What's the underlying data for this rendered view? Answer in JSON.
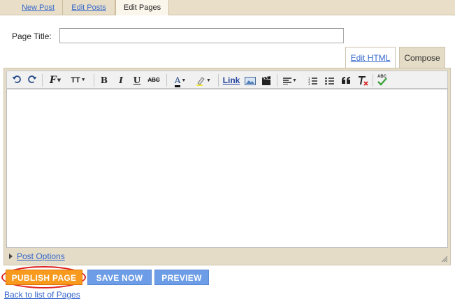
{
  "top_tabs": [
    {
      "label": "New Post"
    },
    {
      "label": "Edit Posts"
    },
    {
      "label": "Edit Pages"
    }
  ],
  "form": {
    "title_label": "Page Title:",
    "title_value": "",
    "title_placeholder": ""
  },
  "editor": {
    "mode_tabs": {
      "html": "Edit HTML",
      "compose": "Compose"
    },
    "toolbar": {
      "bold": "B",
      "italic": "I",
      "underline": "U",
      "strike": "ABC",
      "font": "F",
      "size": "TT",
      "text_color": "A",
      "link": "Link",
      "spellcheck": "ABC"
    },
    "post_options": "Post Options"
  },
  "buttons": {
    "publish": "PUBLISH PAGE",
    "save": "SAVE NOW",
    "preview": "PREVIEW"
  },
  "back_link": "Back to list of Pages",
  "colors": {
    "tab_bar": "#e9dfc8",
    "frame": "#e5dcc7",
    "link": "#3366cc",
    "publish": "#f79a1e",
    "secondary": "#6d9de6",
    "highlight_ring": "#e02020"
  }
}
